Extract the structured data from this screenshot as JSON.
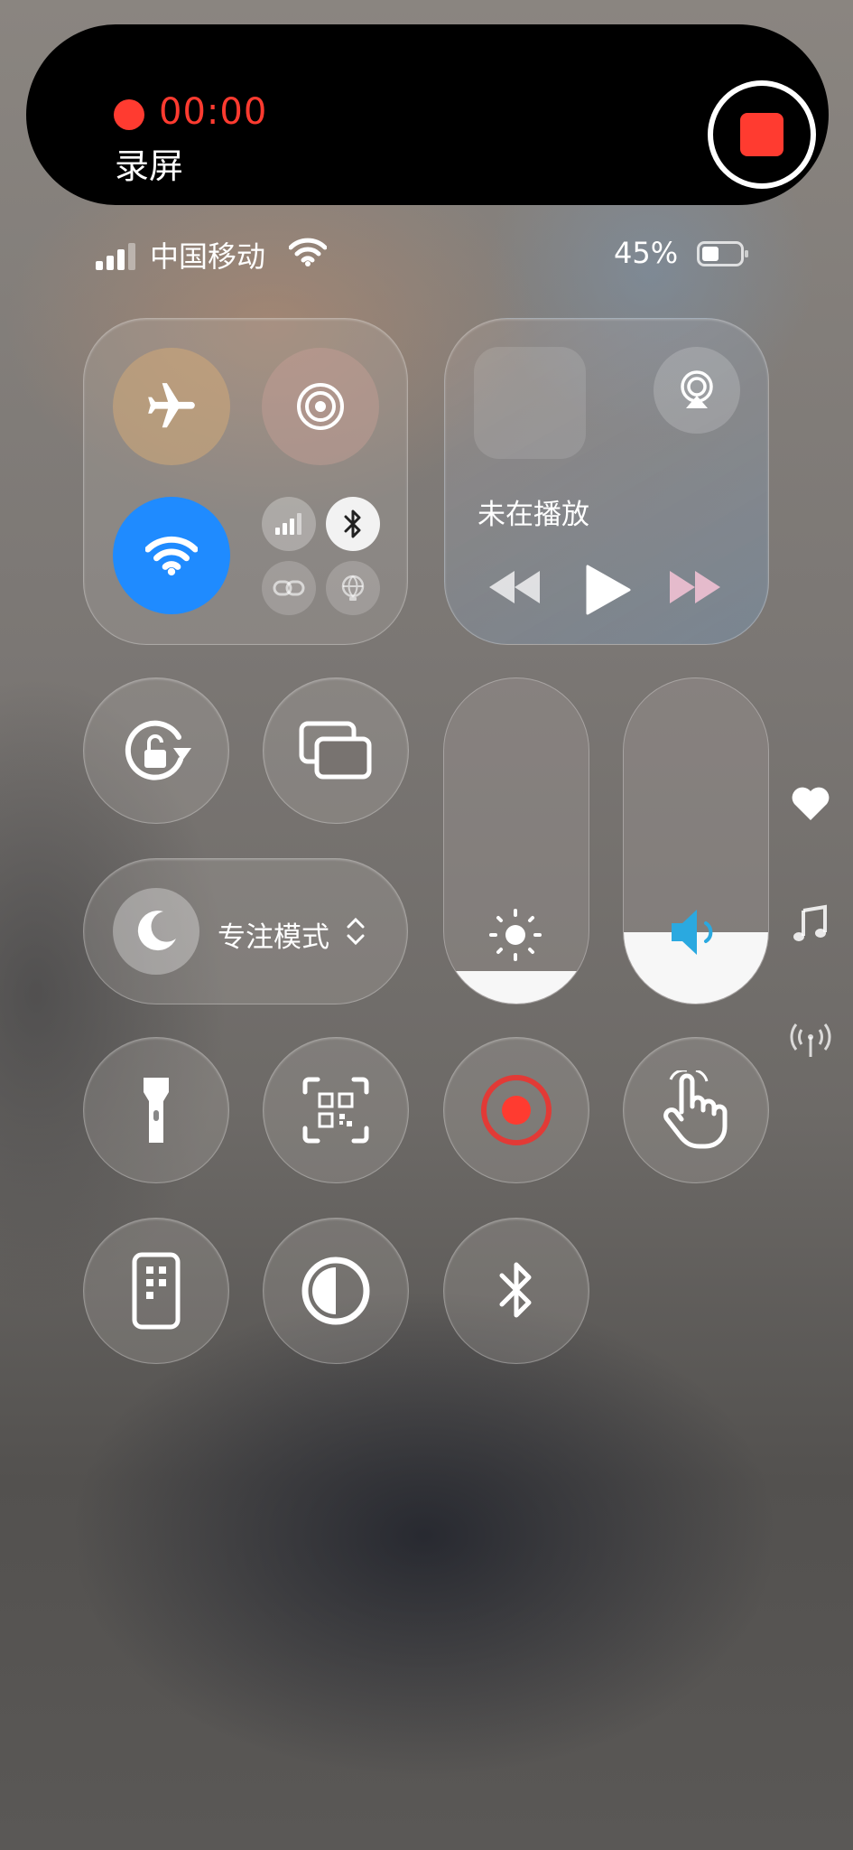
{
  "recording": {
    "time": "00:00",
    "title": "录屏"
  },
  "status_bar": {
    "carrier": "中国移动",
    "battery_percent": "45%",
    "battery_level": 0.45
  },
  "connectivity": {
    "airplane_mode": "airplane-icon",
    "airdrop": "airdrop-icon",
    "wifi": {
      "icon": "wifi-icon",
      "active_color": "#1f8bff"
    },
    "cellular": "cellular-icon",
    "bluetooth": "bluetooth-icon",
    "vpn": "vpn-icon",
    "globe": "globe-icon"
  },
  "media": {
    "status": "未在播放"
  },
  "focus": {
    "label": "专注模式"
  },
  "sliders": {
    "brightness_level": 0.1,
    "volume_level": 0.22,
    "volume_icon_color": "#2aa9e0"
  },
  "controls": {
    "screen_record_color": "#ff3b30"
  },
  "page_indicators": [
    "heart-icon",
    "music-note-icon",
    "antenna-icon"
  ]
}
